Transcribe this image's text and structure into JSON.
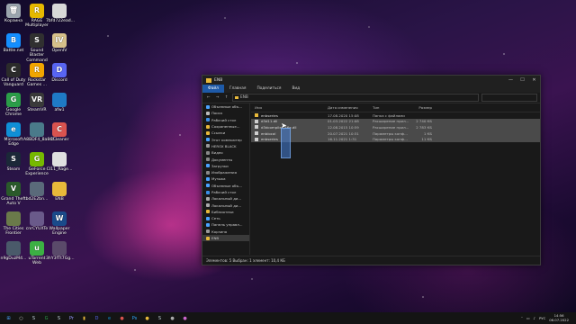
{
  "desktop": {
    "icons": [
      {
        "label": "Корзина",
        "icon": "recycle-bin-icon",
        "color": "#9aa4ad",
        "glyph": "🗑"
      },
      {
        "label": "RAGE Multiplayer",
        "icon": "rage-mp-icon",
        "color": "#e6b800",
        "glyph": "R"
      },
      {
        "label": "7bfd722ead...",
        "icon": "file-icon",
        "color": "#d8d8d8",
        "glyph": ""
      },
      {
        "label": "Battle.net",
        "icon": "battlenet-icon",
        "color": "#148eff",
        "glyph": "B"
      },
      {
        "label": "Sound Blaster Command",
        "icon": "soundblaster-icon",
        "color": "#303030",
        "glyph": "S"
      },
      {
        "label": "OpenIV",
        "icon": "openiv-icon",
        "color": "#d6c08a",
        "glyph": "IV"
      },
      {
        "label": "Call of Duty Vanguard",
        "icon": "callofduty-icon",
        "color": "#2b2b2b",
        "glyph": "C"
      },
      {
        "label": "Rockstar Games ...",
        "icon": "rockstar-icon",
        "color": "#f0a500",
        "glyph": "R"
      },
      {
        "label": "Discord",
        "icon": "discord-icon",
        "color": "#5865f2",
        "glyph": "D"
      },
      {
        "label": "Google Chrome",
        "icon": "chrome-icon",
        "color": "#2b9d48",
        "glyph": "G"
      },
      {
        "label": "SteamVR",
        "icon": "steamvr-icon",
        "color": "#3a3a3a",
        "glyph": "VR"
      },
      {
        "label": "afw1",
        "icon": "app-icon",
        "color": "#1f7ac6",
        "glyph": ""
      },
      {
        "label": "Microsoft Edge",
        "icon": "edge-icon",
        "color": "#0f8fd6",
        "glyph": "e"
      },
      {
        "label": "A8BDF4_8a84f...",
        "icon": "image-file-icon",
        "color": "#4a7a8a",
        "glyph": ""
      },
      {
        "label": "CCleaner",
        "icon": "ccleaner-icon",
        "color": "#d9534f",
        "glyph": "C"
      },
      {
        "label": "Steam",
        "icon": "steam-icon",
        "color": "#1b2838",
        "glyph": "S"
      },
      {
        "label": "GeForce Experience",
        "icon": "geforce-icon",
        "color": "#76b900",
        "glyph": "G"
      },
      {
        "label": "CI11_Rage...",
        "icon": "file-icon",
        "color": "#e0e0e0",
        "glyph": ""
      },
      {
        "label": "Grand Theft Auto V",
        "icon": "gtav-icon",
        "color": "#2a5a2a",
        "glyph": "V"
      },
      {
        "label": "bd2E2bn...",
        "icon": "image-file-icon",
        "color": "#5a6a7a",
        "glyph": ""
      },
      {
        "label": "ENB",
        "icon": "folder-icon",
        "color": "#e8b93a",
        "glyph": ""
      },
      {
        "label": "The Cities Frontier",
        "icon": "game-icon",
        "color": "#6a7a4a",
        "glyph": ""
      },
      {
        "label": "cnrCYUXTe",
        "icon": "image-file-icon",
        "color": "#6a5a8a",
        "glyph": ""
      },
      {
        "label": "Wallpaper Engine",
        "icon": "wallpaper-engine-icon",
        "color": "#1a4a8a",
        "glyph": "W"
      },
      {
        "label": "n9gDuzM4...",
        "icon": "image-file-icon",
        "color": "#4a5a6a",
        "glyph": ""
      },
      {
        "label": "uTorrent Web",
        "icon": "utorrent-icon",
        "color": "#3cb043",
        "glyph": "u"
      },
      {
        "label": "3hY3fTt7Gg...",
        "icon": "image-file-icon",
        "color": "#5a4a6a",
        "glyph": ""
      }
    ]
  },
  "explorer": {
    "title": "ENB",
    "tabs": [
      "Файл",
      "Главная",
      "Поделиться",
      "Вид"
    ],
    "active_tab": 0,
    "path": "ENB",
    "nav": [
      {
        "label": "Объемные объ...",
        "icon": "cube-icon",
        "color": "#4aa3ff"
      },
      {
        "label": "Поиск",
        "icon": "search-icon",
        "color": "#bbbbbb"
      },
      {
        "label": "Рабочий стол",
        "icon": "desktop-icon",
        "color": "#3a8ee6"
      },
      {
        "label": "Сохраненные...",
        "icon": "star-icon",
        "color": "#e8b93a"
      },
      {
        "label": "Ссылки",
        "icon": "link-icon",
        "color": "#e8b93a"
      },
      {
        "label": "Этот компьютер",
        "icon": "computer-icon",
        "color": "#4aa3ff"
      },
      {
        "label": "HEROX BLACK",
        "icon": "drive-icon",
        "color": "#999999"
      },
      {
        "label": "Видео",
        "icon": "video-icon",
        "color": "#888888"
      },
      {
        "label": "Документы",
        "icon": "documents-icon",
        "color": "#888888"
      },
      {
        "label": "Загрузки",
        "icon": "downloads-icon",
        "color": "#4aa3ff"
      },
      {
        "label": "Изображения",
        "icon": "pictures-icon",
        "color": "#888888"
      },
      {
        "label": "Музыка",
        "icon": "music-icon",
        "color": "#4aa3ff"
      },
      {
        "label": "Объемные объ...",
        "icon": "cube-icon",
        "color": "#4aa3ff"
      },
      {
        "label": "Рабочий стол",
        "icon": "desktop-icon",
        "color": "#3a8ee6"
      },
      {
        "label": "Локальный ди...",
        "icon": "drive-icon",
        "color": "#aaaaaa"
      },
      {
        "label": "Локальный ди...",
        "icon": "drive-icon",
        "color": "#aaaaaa"
      },
      {
        "label": "Библиотеки",
        "icon": "library-icon",
        "color": "#e8b93a"
      },
      {
        "label": "Сеть",
        "icon": "network-icon",
        "color": "#4aa3ff"
      },
      {
        "label": "Панель управл...",
        "icon": "control-panel-icon",
        "color": "#4aa3ff"
      },
      {
        "label": "Корзина",
        "icon": "recycle-bin-icon",
        "color": "#999999"
      },
      {
        "label": "ENB",
        "icon": "folder-icon",
        "color": "#e8b93a"
      }
    ],
    "selected_nav": 20,
    "columns": [
      "Имя",
      "Дата изменения",
      "Тип",
      "Размер"
    ],
    "files": [
      {
        "name": "enbseries",
        "date": "17.08.2020 15:08",
        "type": "Папка с файлами",
        "size": "",
        "icon": "folder-icon",
        "color": "#e8b93a",
        "selected": false
      },
      {
        "name": "d3d11.dll",
        "date": "01.03.2022 21:08",
        "type": "Расширение прил...",
        "size": "2 740 КБ",
        "icon": "dll-file-icon",
        "color": "#cfcfcf",
        "selected": true
      },
      {
        "name": "d3dcompiler_46e.dll",
        "date": "12.08.2015 10:59",
        "type": "Расширение прил...",
        "size": "2 783 КБ",
        "icon": "dll-file-icon",
        "color": "#cfcfcf",
        "selected": true
      },
      {
        "name": "enblocal",
        "date": "20.07.2021 10:31",
        "type": "Параметры конф...",
        "size": "1 КБ",
        "icon": "config-file-icon",
        "color": "#cfcfcf",
        "selected": true
      },
      {
        "name": "enbseries",
        "date": "16.11.2021 1:31",
        "type": "Параметры конф...",
        "size": "11 КБ",
        "icon": "config-file-icon",
        "color": "#cfcfcf",
        "selected": true
      }
    ],
    "status": "Элементов: 5   Выбран: 1 элемент: 10,4 КБ"
  },
  "taskbar": {
    "items": [
      {
        "icon": "start-icon",
        "color": "#4aa3ff",
        "glyph": "⊞"
      },
      {
        "icon": "search-icon",
        "color": "#cccccc",
        "glyph": "○"
      },
      {
        "icon": "steam-icon",
        "color": "#c7d5e0",
        "glyph": "S"
      },
      {
        "icon": "chrome-icon",
        "color": "#2b9d48",
        "glyph": "G"
      },
      {
        "icon": "steam-icon",
        "color": "#c7d5e0",
        "glyph": "S"
      },
      {
        "icon": "premiere-icon",
        "color": "#9999ff",
        "glyph": "Pr"
      },
      {
        "icon": "folder-icon",
        "color": "#e8b93a",
        "glyph": "▮"
      },
      {
        "icon": "discord-icon",
        "color": "#5865f2",
        "glyph": "D"
      },
      {
        "icon": "edge-icon",
        "color": "#0f8fd6",
        "glyph": "e"
      },
      {
        "icon": "app-icon",
        "color": "#d9534f",
        "glyph": "●"
      },
      {
        "icon": "photoshop-icon",
        "color": "#31a8ff",
        "glyph": "Ps"
      },
      {
        "icon": "app-icon",
        "color": "#e8b93a",
        "glyph": "●"
      },
      {
        "icon": "steam-icon",
        "color": "#c7d5e0",
        "glyph": "S"
      },
      {
        "icon": "app-icon",
        "color": "#aaaaaa",
        "glyph": "●"
      },
      {
        "icon": "app-icon",
        "color": "#cc66cc",
        "glyph": "●"
      }
    ],
    "lang": "РУС",
    "time": "14:56",
    "date": "06.07.2022"
  }
}
